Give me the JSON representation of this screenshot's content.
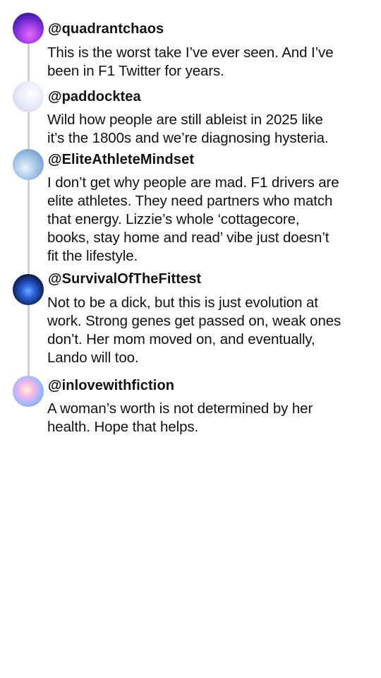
{
  "replies": [
    {
      "handle": "@quadrantchaos",
      "avatar_icon": "purple-abstract-avatar",
      "lines": [
        "This is the worst take I’ve ever seen. And I’ve",
        "been in F1 Twitter for years."
      ]
    },
    {
      "handle": "@paddocktea",
      "avatar_icon": "pale-cloud-avatar",
      "lines": [
        "Wild how people are still ableist in 2025 like",
        "it’s the 1800s and we’re diagnosing hysteria."
      ]
    },
    {
      "handle": "@EliteAthleteMindset",
      "avatar_icon": "blue-crystal-avatar",
      "lines": [
        "I don’t get why people are mad. F1 drivers are",
        "elite athletes. They need partners who match",
        "that energy. Lizzie’s whole ‘cottagecore,",
        "books, stay home and read’ vibe just doesn’t",
        "fit the lifestyle."
      ]
    },
    {
      "handle": "@SurvivalOfTheFittest",
      "avatar_icon": "blue-lotus-avatar",
      "lines": [
        "Not to be a dick, but this is just evolution at",
        "work. Strong genes get passed on, weak ones",
        "don’t. Her mom moved on, and eventually,",
        "Lando will too."
      ]
    },
    {
      "handle": "@inlovewithfiction",
      "avatar_icon": "holographic-avatar",
      "lines": [
        "A woman’s worth is not determined by her",
        "health. Hope that helps."
      ]
    }
  ]
}
